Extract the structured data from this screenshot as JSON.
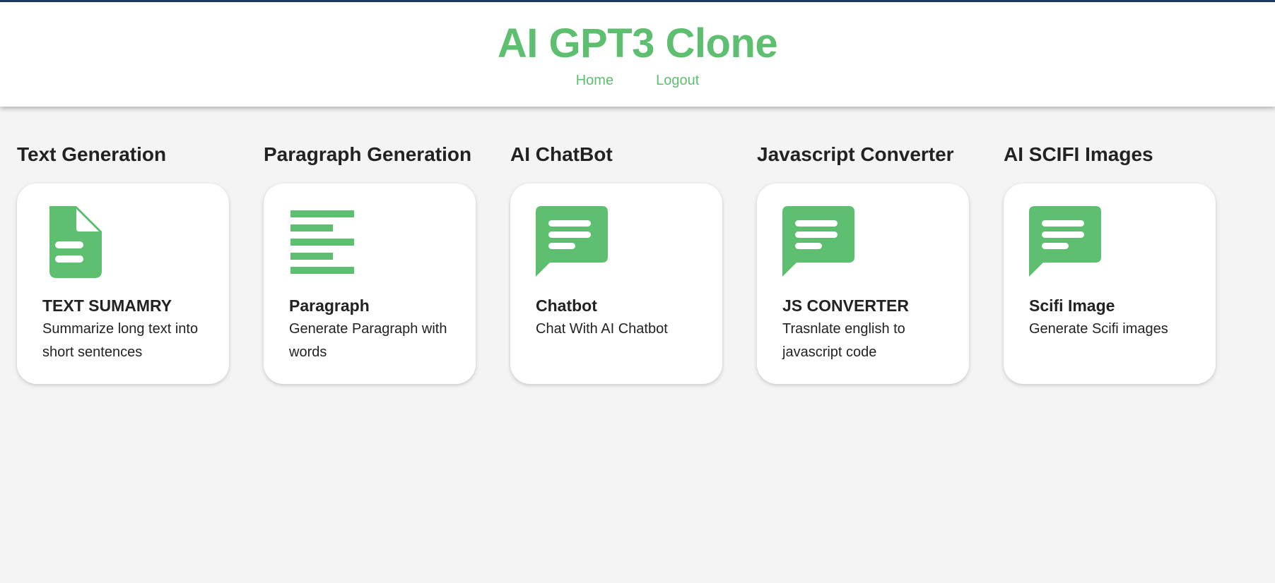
{
  "header": {
    "title": "AI GPT3 Clone",
    "nav": [
      "Home",
      "Logout"
    ]
  },
  "colors": {
    "accent": "#5dbf6f",
    "top_line": "#1f3a64",
    "background": "#f4f4f4"
  },
  "columns": [
    {
      "heading": "Text Generation",
      "card_title": "TEXT SUMAMRY",
      "card_desc": "Summarize long text into short sentences",
      "icon": "document-icon"
    },
    {
      "heading": "Paragraph Generation",
      "card_title": "Paragraph",
      "card_desc": "Generate Paragraph with words",
      "icon": "align-left-icon"
    },
    {
      "heading": "AI ChatBot",
      "card_title": "Chatbot",
      "card_desc": "Chat With AI Chatbot",
      "icon": "chat-icon"
    },
    {
      "heading": "Javascript Converter",
      "card_title": "JS CONVERTER",
      "card_desc": "Trasnlate english to javascript code",
      "icon": "chat-icon"
    },
    {
      "heading": "AI SCIFI Images",
      "card_title": "Scifi Image",
      "card_desc": "Generate Scifi images",
      "icon": "chat-icon"
    }
  ]
}
